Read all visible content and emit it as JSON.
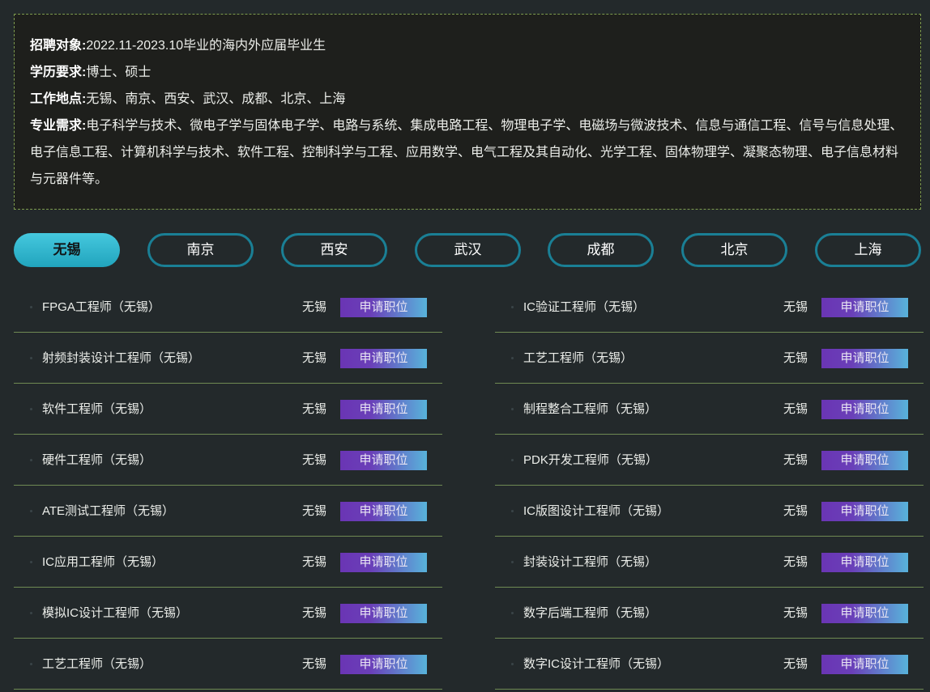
{
  "info": {
    "target_label": "招聘对象:",
    "target_value": "2022.11-2023.10毕业的海内外应届毕业生",
    "edu_label": "学历要求:",
    "edu_value": "博士、硕士",
    "location_label": "工作地点:",
    "location_value": "无锡、南京、西安、武汉、成都、北京、上海",
    "major_label": "专业需求:",
    "major_value": "电子科学与技术、微电子学与固体电子学、电路与系统、集成电路工程、物理电子学、电磁场与微波技术、信息与通信工程、信号与信息处理、电子信息工程、计算机科学与技术、软件工程、控制科学与工程、应用数学、电气工程及其自动化、光学工程、固体物理学、凝聚态物理、电子信息材料与元器件等。"
  },
  "tabs": [
    "无锡",
    "南京",
    "西安",
    "武汉",
    "成都",
    "北京",
    "上海"
  ],
  "active_tab": "无锡",
  "apply_label": "申请职位",
  "jobs_left": [
    {
      "title": "FPGA工程师（无锡）",
      "location": "无锡"
    },
    {
      "title": "射频封装设计工程师（无锡）",
      "location": "无锡"
    },
    {
      "title": "软件工程师（无锡）",
      "location": "无锡"
    },
    {
      "title": "硬件工程师（无锡）",
      "location": "无锡"
    },
    {
      "title": "ATE测试工程师（无锡）",
      "location": "无锡"
    },
    {
      "title": "IC应用工程师（无锡）",
      "location": "无锡"
    },
    {
      "title": "模拟IC设计工程师（无锡）",
      "location": "无锡"
    },
    {
      "title": "工艺工程师（无锡）",
      "location": "无锡"
    }
  ],
  "jobs_right": [
    {
      "title": "IC验证工程师（无锡）",
      "location": "无锡"
    },
    {
      "title": "工艺工程师（无锡）",
      "location": "无锡"
    },
    {
      "title": "制程整合工程师（无锡）",
      "location": "无锡"
    },
    {
      "title": "PDK开发工程师（无锡）",
      "location": "无锡"
    },
    {
      "title": "IC版图设计工程师（无锡）",
      "location": "无锡"
    },
    {
      "title": "封装设计工程师（无锡）",
      "location": "无锡"
    },
    {
      "title": "数字后端工程师（无锡）",
      "location": "无锡"
    },
    {
      "title": "数字IC设计工程师（无锡）",
      "location": "无锡"
    }
  ]
}
